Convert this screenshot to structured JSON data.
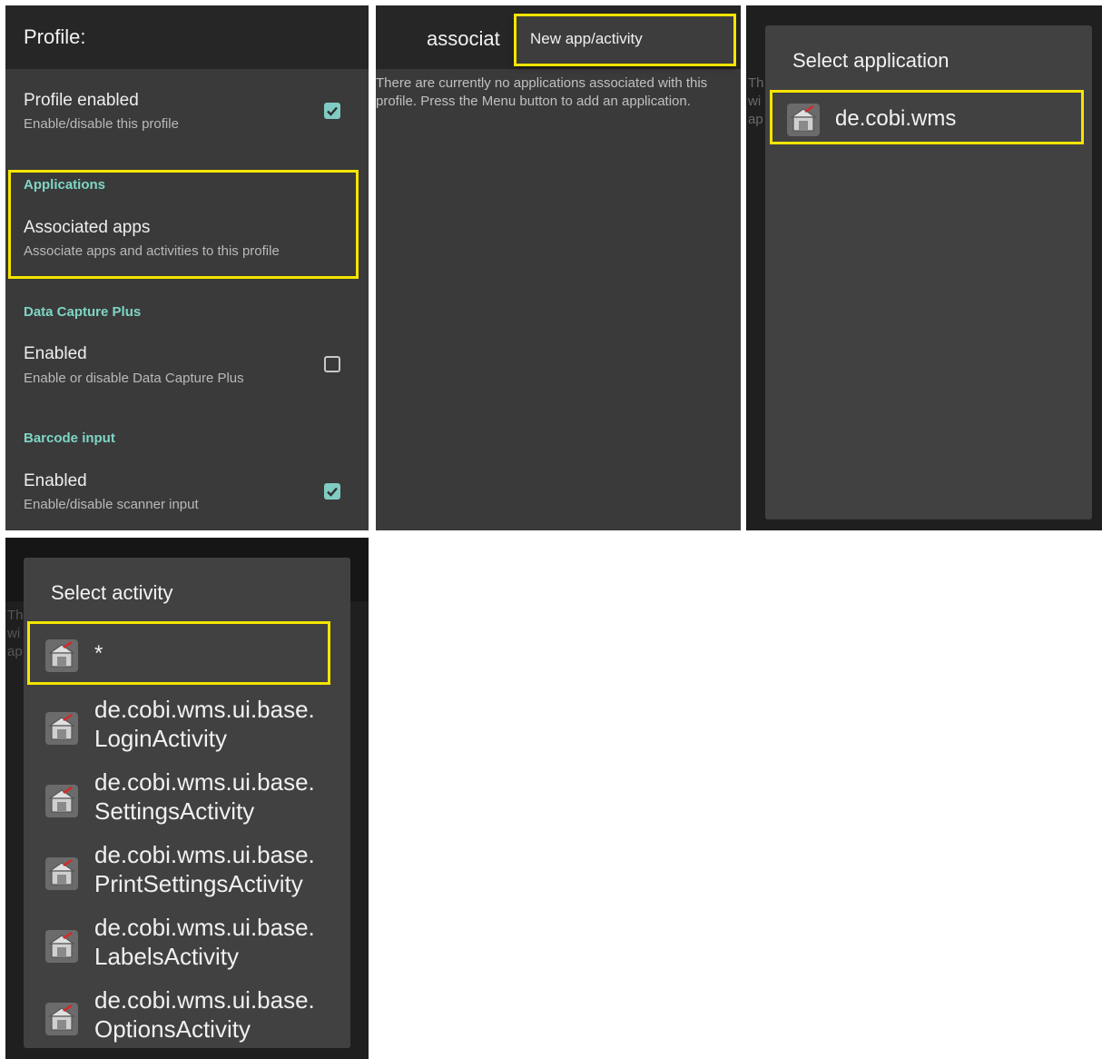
{
  "profile_screen": {
    "title": "Profile:",
    "profile_enabled": {
      "title": "Profile enabled",
      "subtitle": "Enable/disable this profile",
      "checked": true
    },
    "applications": {
      "category": "Applications",
      "associated_apps": {
        "title": "Associated apps",
        "subtitle": "Associate apps and activities to this profile"
      }
    },
    "data_capture_plus": {
      "category": "Data Capture Plus",
      "enabled": {
        "title": "Enabled",
        "subtitle": "Enable or disable Data Capture Plus",
        "checked": false
      }
    },
    "barcode_input": {
      "category": "Barcode input",
      "enabled": {
        "title": "Enabled",
        "subtitle": "Enable/disable scanner input",
        "checked": true
      }
    }
  },
  "associated_screen": {
    "title": "associat",
    "menu_item": "New app/activity",
    "empty_message": "There are currently no applications associated with this profile. Press the Menu button to add an application."
  },
  "select_application": {
    "title": "Select application",
    "background_fragments": [
      "Th",
      "wi",
      "ap"
    ],
    "items": [
      {
        "label": "de.cobi.wms",
        "icon": "warehouse-app-icon"
      }
    ]
  },
  "select_activity": {
    "title": "Select activity",
    "background_fragments": [
      "Th",
      "wi",
      "ap"
    ],
    "items": [
      {
        "line1": "*",
        "line2": "",
        "icon": "warehouse-app-icon"
      },
      {
        "line1": "de.cobi.wms.ui.base.",
        "line2": "LoginActivity",
        "icon": "warehouse-app-icon"
      },
      {
        "line1": "de.cobi.wms.ui.base.",
        "line2": "SettingsActivity",
        "icon": "warehouse-app-icon"
      },
      {
        "line1": "de.cobi.wms.ui.base.",
        "line2": "PrintSettingsActivity",
        "icon": "warehouse-app-icon"
      },
      {
        "line1": "de.cobi.wms.ui.base.",
        "line2": "LabelsActivity",
        "icon": "warehouse-app-icon"
      },
      {
        "line1": "de.cobi.wms.ui.base.",
        "line2": "OptionsActivity",
        "icon": "warehouse-app-icon"
      }
    ]
  },
  "colors": {
    "highlight": "#f5e400",
    "accent_teal": "#7fd6c5",
    "checkbox_on": "#80cbc4",
    "panel_bg": "#3a3a3a",
    "dialog_bg": "#414141",
    "topbar_bg": "#262626"
  }
}
